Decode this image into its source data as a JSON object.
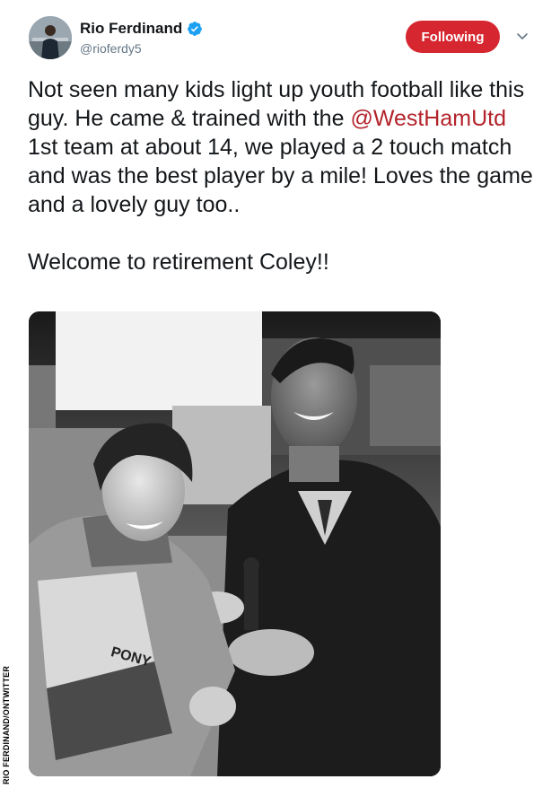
{
  "author": {
    "display_name": "Rio Ferdinand",
    "handle": "@rioferdy5",
    "avatar_icon": "profile-avatar",
    "verified_icon": "verified-badge-icon"
  },
  "follow_button": {
    "label": "Following",
    "color": "#d6262f"
  },
  "menu_icon": "chevron-down-icon",
  "tweet": {
    "line1_pre": "Not seen many kids light up youth football like this guy. He came & trained with the ",
    "mention": "@WestHamUtd",
    "line1_post": " 1st team at about 14, we played a 2 touch match and was the best player by a mile! Loves the game and a lovely guy too..",
    "line2": "Welcome to retirement Coley!!"
  },
  "photo": {
    "credit": "RIO FERDINAND/ONTWITTER"
  },
  "colors": {
    "mention": "#b3232b",
    "text": "#14171a",
    "secondary": "#657786"
  }
}
